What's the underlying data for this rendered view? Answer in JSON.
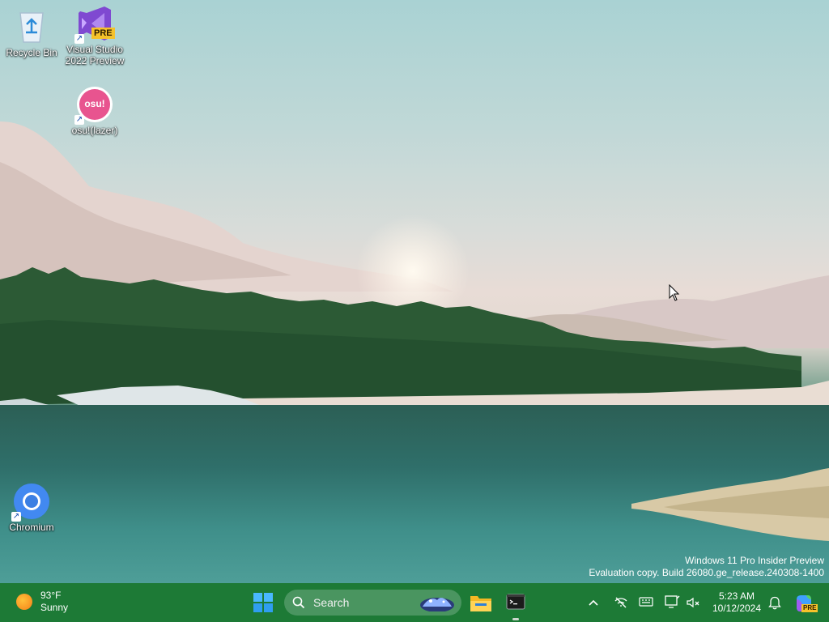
{
  "desktop": {
    "icons": [
      {
        "name": "recycle-bin",
        "label": "Recycle Bin"
      },
      {
        "name": "visual-studio",
        "label": "Visual Studio 2022 Preview",
        "badge": "PRE"
      },
      {
        "name": "osu",
        "label": "osu!(lazer)",
        "logo": "osu!"
      },
      {
        "name": "chromium",
        "label": "Chromium"
      }
    ],
    "watermark": {
      "line1": "Windows 11 Pro Insider Preview",
      "line2": "Evaluation copy. Build 26080.ge_release.240308-1400"
    }
  },
  "taskbar": {
    "weather": {
      "temp": "93°F",
      "condition": "Sunny",
      "icon": "sun-icon"
    },
    "search": {
      "placeholder": "Search"
    },
    "apps": [
      {
        "name": "file-explorer",
        "icon": "folder-icon",
        "active": false
      },
      {
        "name": "terminal",
        "icon": "terminal-icon",
        "active": true
      }
    ],
    "tray": {
      "icons": [
        "chevron-up-icon",
        "network-off-icon",
        "keyboard-icon",
        "display-icon",
        "volume-muted-icon"
      ],
      "time": "5:23 AM",
      "date": "10/12/2024",
      "notifications_icon": "bell-icon",
      "copilot_badge": "PRE"
    }
  },
  "colors": {
    "taskbar": "#1d7a36",
    "search_box": "#4a9560",
    "windows_logo": "#3ab0ff"
  }
}
